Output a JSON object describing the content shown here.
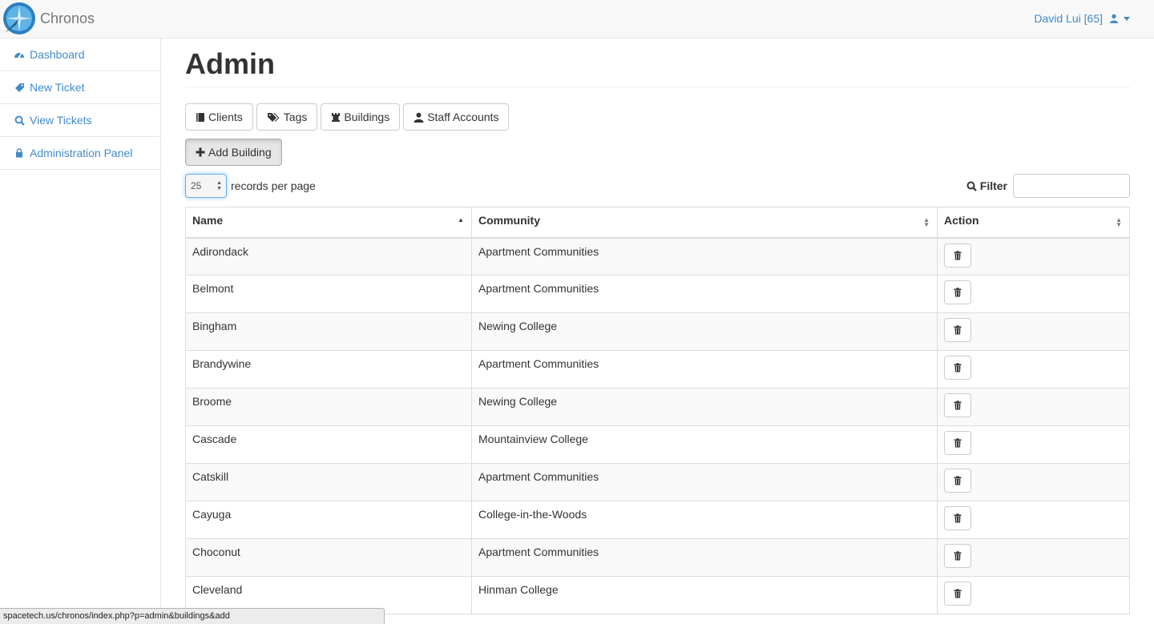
{
  "app": {
    "name": "Chronos"
  },
  "user": {
    "label": "David Lui [65]"
  },
  "sidebar": {
    "items": [
      {
        "label": "Dashboard"
      },
      {
        "label": "New Ticket"
      },
      {
        "label": "View Tickets"
      },
      {
        "label": "Administration Panel"
      }
    ]
  },
  "page": {
    "title": "Admin"
  },
  "tabs": [
    {
      "label": "Clients"
    },
    {
      "label": "Tags"
    },
    {
      "label": "Buildings"
    },
    {
      "label": "Staff Accounts"
    }
  ],
  "add_button": {
    "label": "Add Building"
  },
  "length": {
    "value": "25",
    "label": "records per page"
  },
  "filter": {
    "label": "Filter",
    "value": ""
  },
  "table": {
    "columns": [
      "Name",
      "Community",
      "Action"
    ],
    "rows": [
      {
        "name": "Adirondack",
        "community": "Apartment Communities"
      },
      {
        "name": "Belmont",
        "community": "Apartment Communities"
      },
      {
        "name": "Bingham",
        "community": "Newing College"
      },
      {
        "name": "Brandywine",
        "community": "Apartment Communities"
      },
      {
        "name": "Broome",
        "community": "Newing College"
      },
      {
        "name": "Cascade",
        "community": "Mountainview College"
      },
      {
        "name": "Catskill",
        "community": "Apartment Communities"
      },
      {
        "name": "Cayuga",
        "community": "College-in-the-Woods"
      },
      {
        "name": "Choconut",
        "community": "Apartment Communities"
      },
      {
        "name": "Cleveland",
        "community": "Hinman College"
      }
    ]
  },
  "status_bar": {
    "url": "spacetech.us/chronos/index.php?p=admin&buildings&add"
  },
  "colors": {
    "link": "#428bca",
    "navbar_bg": "#f8f8f8",
    "border": "#dddddd"
  }
}
